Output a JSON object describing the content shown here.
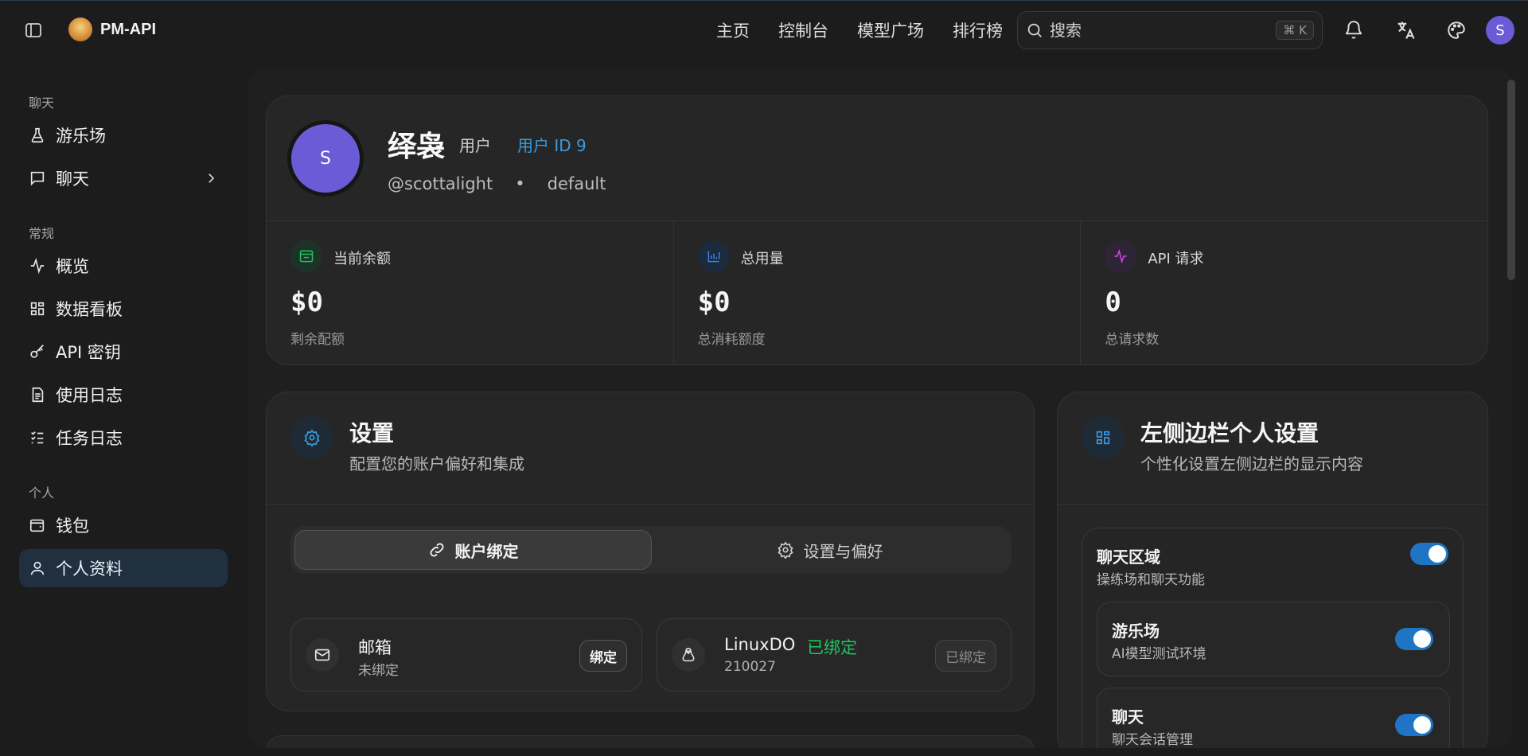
{
  "header": {
    "brand": "PM-API",
    "nav": [
      "主页",
      "控制台",
      "模型广场",
      "排行榜"
    ],
    "search_placeholder": "搜索",
    "search_shortcut": "⌘ K",
    "avatar_initial": "S"
  },
  "sidebar": {
    "sections": [
      {
        "title": "聊天",
        "items": [
          {
            "label": "游乐场",
            "icon": "flask-icon"
          },
          {
            "label": "聊天",
            "icon": "chat-icon"
          }
        ]
      },
      {
        "title": "常规",
        "items": [
          {
            "label": "概览",
            "icon": "activity-icon"
          },
          {
            "label": "数据看板",
            "icon": "grid-icon"
          },
          {
            "label": "API 密钥",
            "icon": "key-icon"
          },
          {
            "label": "使用日志",
            "icon": "document-icon"
          },
          {
            "label": "任务日志",
            "icon": "list-icon"
          }
        ]
      },
      {
        "title": "个人",
        "items": [
          {
            "label": "钱包",
            "icon": "wallet-icon"
          },
          {
            "label": "个人资料",
            "icon": "user-icon",
            "active": true
          }
        ]
      }
    ]
  },
  "profile": {
    "avatar_initial": "S",
    "name": "绎袅",
    "role": "用户",
    "user_id": "用户 ID 9",
    "username": "@scottalight",
    "separator": "•",
    "group": "default",
    "stats": [
      {
        "label": "当前余额",
        "value": "$0",
        "sub": "剩余配额",
        "icon": "wallet-icon",
        "color": "#22c55e"
      },
      {
        "label": "总用量",
        "value": "$0",
        "sub": "总消耗额度",
        "icon": "bar-chart-icon",
        "color": "#3b82f6"
      },
      {
        "label": "API 请求",
        "value": "0",
        "sub": "总请求数",
        "icon": "activity-icon",
        "color": "#d946ef"
      }
    ]
  },
  "settings": {
    "title": "设置",
    "subtitle": "配置您的账户偏好和集成",
    "tabs": [
      "账户绑定",
      "设置与偏好"
    ],
    "bindings": [
      {
        "title": "邮箱",
        "sub": "未绑定",
        "button": "绑定"
      },
      {
        "title": "LinuxDO",
        "status": "已绑定",
        "sub": "210027",
        "button": "已绑定"
      }
    ]
  },
  "sidebar_settings": {
    "title": "左侧边栏个人设置",
    "subtitle": "个性化设置左侧边栏的显示内容",
    "group_title": "聊天区域",
    "group_sub": "操练场和聊天功能",
    "items": [
      {
        "title": "游乐场",
        "sub": "AI模型测试环境",
        "enabled": true
      },
      {
        "title": "聊天",
        "sub": "聊天会话管理",
        "enabled": true
      }
    ]
  }
}
